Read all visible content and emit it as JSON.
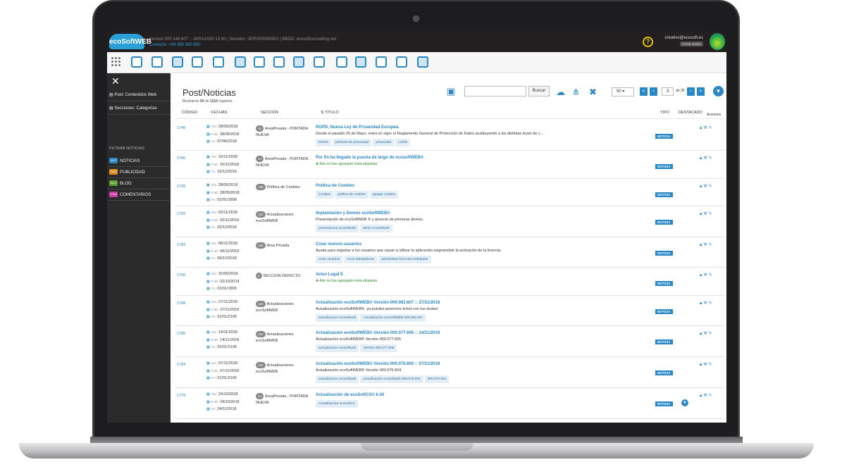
{
  "header": {
    "logo_text": "ecoSoftWEB",
    "version_line": "Versión 000.146.607 :: 16/01/2020 13:00 | Servidor: SERVERWEB02 | BBDD: ecosoftconsulting.net",
    "contact_line": "Contacto: +34 985 980 890",
    "user_email": "creativo@ecosoft.es",
    "logout_label": "Cerrar sesión"
  },
  "sidebar": {
    "items": [
      {
        "label": "Post: Contenidos Web"
      },
      {
        "label": "Secciones: Categorías"
      }
    ],
    "filter_heading": "FILTRAR NOTICIAS",
    "filters": [
      {
        "tag": "NOT",
        "label": "NOTICIAS",
        "color": "#2a87c6"
      },
      {
        "tag": "PUB",
        "label": "PUBLICIDAD",
        "color": "#e08a1e"
      },
      {
        "tag": "BLG",
        "label": "BLOG",
        "color": "#5aa02c"
      },
      {
        "tag": "COM",
        "label": "COMENTARIOS",
        "color": "#c73aa3"
      }
    ]
  },
  "main": {
    "title": "Post/Noticias",
    "showing_prefix": "Mostrando",
    "showing_count": "50",
    "showing_of": "de",
    "showing_total": "1210",
    "showing_suffix": "registros",
    "search_button": "Buscar",
    "per_page": "50",
    "page_current": "3",
    "page_of": "de 25",
    "columns": {
      "code": "CÓDIGO",
      "dates": "FECHAS",
      "section": "SECCIÓN",
      "title": "TÍTULO",
      "type": "TIPO",
      "featured": "DESTACADO",
      "actions": "Acciones"
    },
    "date_labels": {
      "alta": "Alta:",
      "publi": "Publi:",
      "fin": "Fin:"
    },
    "no_meta_text": "Aún no has agregado meta etiquetas",
    "type_label": "NOTICIA"
  },
  "rows": [
    {
      "code": "1748",
      "alta": "28/05/2018",
      "publi": "28/05/2018",
      "fin": "07/06/2018",
      "badge": "16",
      "section": "AreaPrivada - PORTADA NUEVA",
      "title": "RGPD, Nueva Ley de Privacidad Europea.",
      "desc": "Desde el pasado 25 de Mayo, entra en vigor el Reglamento General de Protección de Datos sustituyendo a las distintas leyes de c...",
      "tags": [
        "RGPD",
        "políticas de privacidad",
        "privacidad",
        "LOPD"
      ],
      "featured": false
    },
    {
      "code": "1786",
      "alta": "16/11/2018",
      "publi": "16/11/2018",
      "fin": "16/12/2018",
      "badge": "14",
      "section": "AreaPrivada - PORTADA NUEVA",
      "title": "Por fin ha llegado la puesta de largo de ecosoftWEB®",
      "desc": "",
      "tags": [],
      "featured": false
    },
    {
      "code": "1749",
      "alta": "28/05/2018",
      "publi": "28/05/2018",
      "fin": "01/01/1899",
      "badge": "138",
      "section": "Política de Cookies",
      "title": "Política de Cookies",
      "desc": "",
      "tags": [
        "Cookies",
        "política de cookies",
        "apagar cookies"
      ],
      "featured": false
    },
    {
      "code": "1782",
      "alta": "02/11/2018",
      "publi": "02/11/2018",
      "fin": "02/12/2018",
      "badge": "122",
      "section": "Actualizaciones ecoSoftWEB",
      "title": "Implantación y Demos ecoSoftWEB®",
      "desc": "Presentación de ecoSoftWEB ® y anuncio de primeras demos.",
      "tags": [
        "presentacion ecosoftweb",
        "demo ecosoftweb"
      ],
      "featured": false
    },
    {
      "code": "1783",
      "alta": "06/11/2018",
      "publi": "06/11/2018",
      "fin": "06/12/2018",
      "badge": "125",
      "section": "Área Privada",
      "title": "Crear nuevos usuarios",
      "desc": "Ayuda para registrar a los usuarios que vayan a utilizar la aplicación asignándole la activación de la licencia.",
      "tags": [
        "crear usuarios",
        "crear trabajadores",
        "administrar licencias trabajador"
      ],
      "featured": false
    },
    {
      "code": "1750",
      "alta": "31/05/2018",
      "publi": "02/10/2014",
      "fin": "01/01/1899",
      "badge": "0",
      "section": "SECCION DEFECTO",
      "title": "Aviso Legal II",
      "desc": "",
      "tags": [],
      "featured": false
    },
    {
      "code": "1788",
      "alta": "27/11/2018",
      "publi": "27/11/2018",
      "fin": "01/01/2100",
      "badge": "122",
      "section": "Actualizaciones ecoSoftWEB",
      "title": "Actualización ecoSoftWEB® Versión 000.083.607 :: 27/11/2018",
      "desc": "Actualización ecoSoftWEB®, ya puedes ponernos ticket con tus dudas!",
      "tags": [
        "actualizacion ecosoftweb",
        "Actualización ecoSoftWEB 000.083.607"
      ],
      "featured": false
    },
    {
      "code": "1785",
      "alta": "14/11/2018",
      "publi": "14/11/2018",
      "fin": "01/01/2100",
      "badge": "122",
      "section": "Actualizaciones ecoSoftWEB",
      "title": "Actualización ecoSoftWEB® Versión 000.077.605 :: 14/11/2018",
      "desc": "Actualización ecoSoftWEB® Versión 000.077.605",
      "tags": [
        "actualizacion ecosoftweb",
        "Versión 000.077.605"
      ],
      "featured": false
    },
    {
      "code": "1784",
      "alta": "07/11/2018",
      "publi": "07/11/2018",
      "fin": "01/01/2100",
      "badge": "122",
      "section": "Actualizaciones ecoSoftWEB",
      "title": "Actualización ecoSoftWEB® Versión 000.076.604 :: 07/11/2018",
      "desc": "Actualización ecoSoftWEB® Versión 000.076.604",
      "tags": [
        "actualizacion ecosoftweb",
        "actualizacion ecosoftweb 000.076.604",
        "000.076.604"
      ],
      "featured": false
    },
    {
      "code": "1779",
      "alta": "24/10/2018",
      "publi": "24/10/2018",
      "fin": "24/11/2018",
      "badge": "14",
      "section": "AreaPrivada - PORTADA NUEVA",
      "title": "Actualización de ecoSoftCS® 6.04",
      "desc": "",
      "tags": [
        "Actualización ecosoftCS"
      ],
      "featured": true
    }
  ]
}
